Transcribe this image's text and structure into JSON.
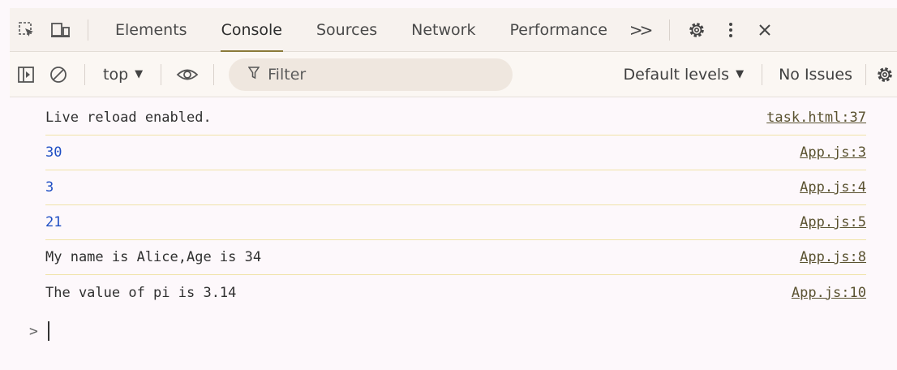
{
  "tabs": {
    "items": [
      {
        "label": "Elements",
        "active": false
      },
      {
        "label": "Console",
        "active": true
      },
      {
        "label": "Sources",
        "active": false
      },
      {
        "label": "Network",
        "active": false
      },
      {
        "label": "Performance",
        "active": false
      }
    ],
    "more_label": ">>",
    "icons": [
      "inspect-element-icon",
      "device-toolbar-icon",
      "settings-icon",
      "more-vert-icon",
      "close-icon"
    ]
  },
  "toolbar": {
    "context": "top",
    "context_arrow": "▼",
    "filter_placeholder": "Filter",
    "levels_label": "Default levels",
    "levels_arrow": "▼",
    "issues_label": "No Issues",
    "icons": [
      "sidebar-toggle-icon",
      "clear-console-icon",
      "eye-icon",
      "filter-icon",
      "console-settings-icon"
    ]
  },
  "console": {
    "messages": [
      {
        "text": "Live reload enabled.",
        "source": "task.html:37",
        "numeric": false
      },
      {
        "text": "30",
        "source": "App.js:3",
        "numeric": true
      },
      {
        "text": "3",
        "source": "App.js:4",
        "numeric": true
      },
      {
        "text": "21",
        "source": "App.js:5",
        "numeric": true
      },
      {
        "text": "My name is Alice,Age is 34",
        "source": "App.js:8",
        "numeric": false
      },
      {
        "text": "The value of pi is 3.14",
        "source": "App.js:10",
        "numeric": false
      }
    ],
    "prompt_symbol": ">"
  },
  "colors": {
    "accent_underline": "#8b7a3a",
    "number_blue": "#1f4fc4",
    "row_separator": "#f0e3a8"
  }
}
